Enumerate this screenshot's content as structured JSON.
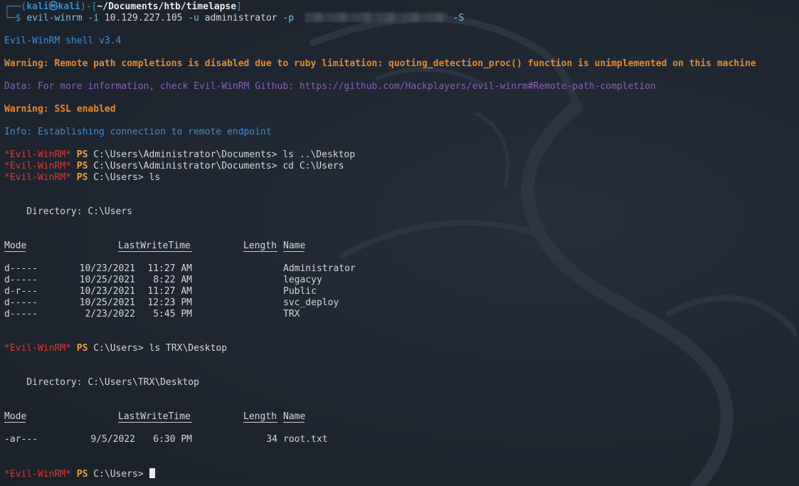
{
  "prompt": {
    "frame_open": "┌──(",
    "user": "kali㉿kali",
    "frame_mid": ")-[",
    "path": "~/Documents/htb/timelapse",
    "frame_close": "]",
    "frame_bottom": "└─$ "
  },
  "command": {
    "tool": "evil-winrm",
    "flag_i": "-i",
    "ip": "10.129.227.105",
    "flag_u": "-u",
    "user": "administrator",
    "flag_p": "-p",
    "flag_s": "-S"
  },
  "output": {
    "version": "Evil-WinRM shell v3.4",
    "warning_completion": "Warning: Remote path completions is disabled due to ruby limitation: quoting_detection_proc() function is unimplemented on this machine",
    "data_info": "Data: For more information, check Evil-WinRM Github: https://github.com/Hackplayers/evil-winrm#Remote-path-completion",
    "warning_ssl": "Warning: SSL enabled",
    "info_connect": "Info: Establishing connection to remote endpoint"
  },
  "ps_prompt": {
    "tag": "*Evil-WinRM*",
    "ps": "PS"
  },
  "commands": [
    {
      "cwd": "C:\\Users\\Administrator\\Documents>",
      "cmd": "ls ..\\Desktop"
    },
    {
      "cwd": "C:\\Users\\Administrator\\Documents>",
      "cmd": "cd C:\\Users"
    },
    {
      "cwd": "C:\\Users>",
      "cmd": "ls"
    },
    {
      "cwd": "C:\\Users>",
      "cmd": "ls TRX\\Desktop"
    },
    {
      "cwd": "C:\\Users>",
      "cmd": ""
    }
  ],
  "listings": [
    {
      "directory": "    Directory: C:\\Users",
      "headers": {
        "mode": "Mode",
        "lwt": "LastWriteTime",
        "length": "Length",
        "name": "Name"
      },
      "rows": [
        {
          "mode": "d-----",
          "date": "10/23/2021",
          "time": "11:27 AM",
          "length": "",
          "name": "Administrator"
        },
        {
          "mode": "d-----",
          "date": "10/25/2021",
          "time": "8:22 AM",
          "length": "",
          "name": "legacyy"
        },
        {
          "mode": "d-r---",
          "date": "10/23/2021",
          "time": "11:27 AM",
          "length": "",
          "name": "Public"
        },
        {
          "mode": "d-----",
          "date": "10/25/2021",
          "time": "12:23 PM",
          "length": "",
          "name": "svc_deploy"
        },
        {
          "mode": "d-----",
          "date": "2/23/2022",
          "time": "5:45 PM",
          "length": "",
          "name": "TRX"
        }
      ]
    },
    {
      "directory": "    Directory: C:\\Users\\TRX\\Desktop",
      "headers": {
        "mode": "Mode",
        "lwt": "LastWriteTime",
        "length": "Length",
        "name": "Name"
      },
      "rows": [
        {
          "mode": "-ar---",
          "date": "9/5/2022",
          "time": "6:30 PM",
          "length": "34",
          "name": "root.txt"
        }
      ]
    }
  ],
  "colors": {
    "background": "#1e2530",
    "prompt_blue": "#3a8fc9",
    "info_blue": "#3b8fd6",
    "warning_orange": "#e88a2e",
    "data_purple": "#8a5fb8",
    "evil_red": "#d63a3a",
    "ps_orange": "#f2a23a"
  }
}
